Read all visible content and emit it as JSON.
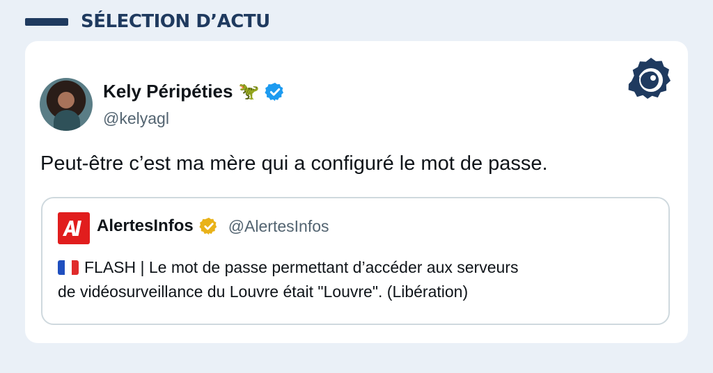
{
  "header": {
    "title": "SÉLECTION D’ACTU"
  },
  "tweet": {
    "author_name": "Kely Péripéties",
    "author_emoji": "🦖",
    "author_handle": "@kelyagl",
    "text": "Peut-être c’est ma mère qui a configuré le mot de passe.",
    "verified_color": "#1d9bf0"
  },
  "quote": {
    "author_name": "AlertesInfos",
    "author_handle": "@AlertesInfos",
    "avatar_text": "AI",
    "text_line1": "FLASH | Le mot de passe permettant d’accéder aux serveurs",
    "text_line2": "de vidéosurveillance du Louvre était \"Louvre\". (Libération)",
    "verified_color": "#e9b219",
    "avatar_color": "#e11d1d"
  },
  "icons": {
    "flag": "france-flag-icon",
    "brand": "brand-logo-icon"
  },
  "colors": {
    "background": "#eaf0f7",
    "header_accent": "#1f3a5f",
    "card": "#ffffff"
  }
}
